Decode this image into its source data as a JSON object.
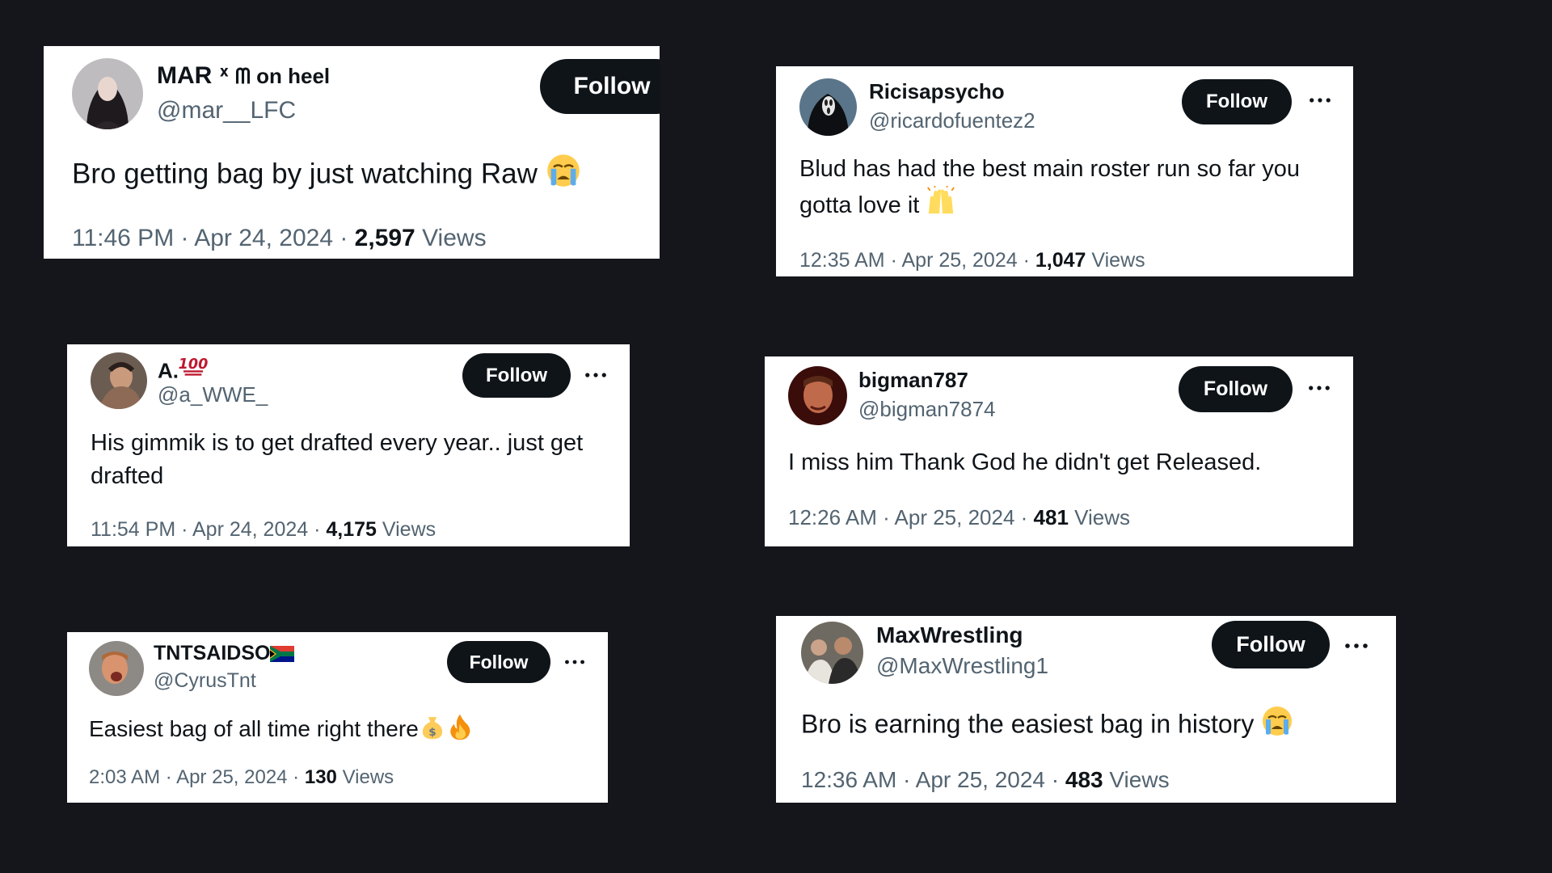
{
  "colors": {
    "background": "#15161b",
    "card": "#ffffff",
    "text": "#0f1419",
    "secondary": "#536471",
    "follow_button": "#0f1419"
  },
  "tweets": [
    {
      "name": "MAR",
      "name_suffix": "ᕽ ᗰ on heel",
      "handle": "@mar__LFC",
      "follow_label": "Follow",
      "text": "Bro getting bag by just watching Raw",
      "emoji": [
        "loudly-crying-face"
      ],
      "time": "11:46 PM",
      "date": "Apr 24, 2024",
      "views": "2,597",
      "views_label": "Views"
    },
    {
      "name": "Ricisapsycho",
      "handle": "@ricardofuentez2",
      "follow_label": "Follow",
      "text": "Blud has had the best main roster run so far you gotta love it",
      "emoji": [
        "raising-hands"
      ],
      "time": "12:35 AM",
      "date": "Apr 25, 2024",
      "views": "1,047",
      "views_label": "Views"
    },
    {
      "name": "A.",
      "name_suffix_emoji": "hundred-points",
      "handle": "@a_WWE_",
      "follow_label": "Follow",
      "text": "His gimmik is to get drafted every year.. just get drafted",
      "time": "11:54 PM",
      "date": "Apr 24, 2024",
      "views": "4,175",
      "views_label": "Views"
    },
    {
      "name": "bigman787",
      "handle": "@bigman7874",
      "follow_label": "Follow",
      "text": "I miss him Thank God he didn't get Released.",
      "time": "12:26 AM",
      "date": "Apr 25, 2024",
      "views": "481",
      "views_label": "Views"
    },
    {
      "name": "TNTSAIDSO",
      "name_suffix_emoji": "flag-south-africa",
      "handle": "@CyrusTnt",
      "follow_label": "Follow",
      "text": "Easiest bag of all time right there",
      "emoji": [
        "money-bag",
        "fire"
      ],
      "time": "2:03 AM",
      "date": "Apr 25, 2024",
      "views": "130",
      "views_label": "Views"
    },
    {
      "name": "MaxWrestling",
      "handle": "@MaxWrestling1",
      "follow_label": "Follow",
      "text": "Bro is earning the easiest bag in history",
      "emoji": [
        "loudly-crying-face"
      ],
      "time": "12:36 AM",
      "date": "Apr 25, 2024",
      "views": "483",
      "views_label": "Views"
    }
  ]
}
